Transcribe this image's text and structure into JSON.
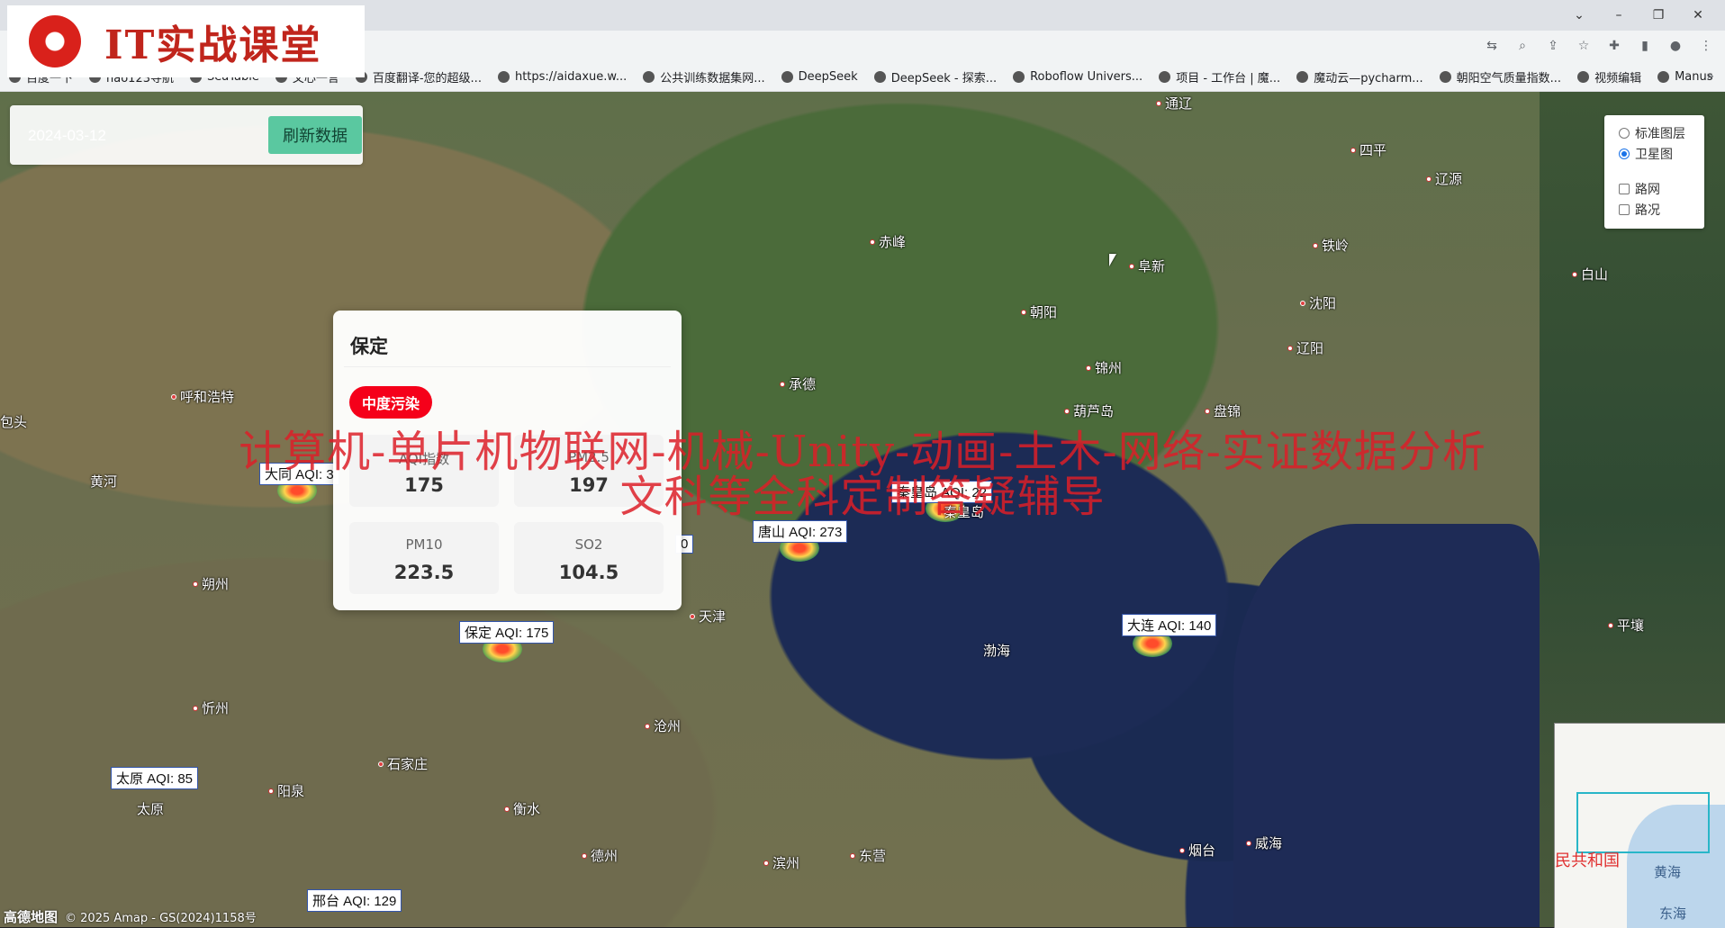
{
  "logo": {
    "text": "IT实战课堂"
  },
  "window": {
    "minimize": "–",
    "restore": "❐",
    "close": "✕",
    "tabs_menu": "⌄"
  },
  "toolbar": {
    "icons": [
      "translate-icon",
      "zoom-icon",
      "share-icon",
      "star-icon",
      "extensions-icon",
      "sidepanel-icon",
      "profile-icon",
      "menu-icon"
    ]
  },
  "bookmarks": [
    {
      "label": "百度一下"
    },
    {
      "label": "hao123导航"
    },
    {
      "label": "SeaTable"
    },
    {
      "label": "文心一言"
    },
    {
      "label": "百度翻译-您的超级..."
    },
    {
      "label": "https://aidaxue.w..."
    },
    {
      "label": "公共训练数据集网..."
    },
    {
      "label": "DeepSeek"
    },
    {
      "label": "DeepSeek - 探索..."
    },
    {
      "label": "Roboflow Univers..."
    },
    {
      "label": "项目 - 工作台 | 魔..."
    },
    {
      "label": "魔动云—pycharm..."
    },
    {
      "label": "朝阳空气质量指数..."
    },
    {
      "label": "视频编辑"
    },
    {
      "label": "Manus"
    }
  ],
  "bookmarks_more": "»",
  "controls": {
    "date_value": "2024-03-12",
    "refresh_label": "刷新数据"
  },
  "layers": {
    "standard": "标准图层",
    "satellite": "卫星图",
    "satellite_selected": true,
    "roadnet": "路网",
    "traffic": "路况"
  },
  "cities": [
    {
      "name": "通辽"
    },
    {
      "name": "四平"
    },
    {
      "name": "辽源"
    },
    {
      "name": "赤峰"
    },
    {
      "name": "铁岭"
    },
    {
      "name": "阜新"
    },
    {
      "name": "白山"
    },
    {
      "name": "沈阳"
    },
    {
      "name": "朝阳"
    },
    {
      "name": "辽阳"
    },
    {
      "name": "锦州"
    },
    {
      "name": "呼和浩特"
    },
    {
      "name": "承德"
    },
    {
      "name": "葫芦岛"
    },
    {
      "name": "盘锦"
    },
    {
      "name": "包头"
    },
    {
      "name": "黄河"
    },
    {
      "name": "秦皇岛"
    },
    {
      "name": "天津"
    },
    {
      "name": "朔州"
    },
    {
      "name": "渤海"
    },
    {
      "name": "平壤"
    },
    {
      "name": "忻州"
    },
    {
      "name": "沧州"
    },
    {
      "name": "石家庄"
    },
    {
      "name": "阳泉"
    },
    {
      "name": "太原"
    },
    {
      "name": "衡水"
    },
    {
      "name": "德州"
    },
    {
      "name": "滨州"
    },
    {
      "name": "东营"
    },
    {
      "name": "烟台"
    },
    {
      "name": "威海"
    }
  ],
  "aqi_labels": [
    {
      "text": "大同 AQI: 3"
    },
    {
      "text": "秦皇岛 AQI: 22"
    },
    {
      "text": "唐山 AQI: 273"
    },
    {
      "text": "0"
    },
    {
      "text": "保定 AQI: 175"
    },
    {
      "text": "大连 AQI: 140"
    },
    {
      "text": "太原 AQI: 85"
    },
    {
      "text": "邢台 AQI: 129"
    }
  ],
  "info_card": {
    "city": "保定",
    "level": "中度污染",
    "level_color": "#f5001a",
    "metrics": [
      {
        "label": "AQI指数",
        "value": "175"
      },
      {
        "label": "PM2.5",
        "value": "197"
      },
      {
        "label": "PM10",
        "value": "223.5"
      },
      {
        "label": "SO2",
        "value": "104.5"
      }
    ]
  },
  "watermark": {
    "line1": "计算机-单片机物联网-机械-Unity-动画-土木-网络-实证数据分析",
    "line2": "文科等全科定制答疑辅导"
  },
  "minimap": {
    "country": "民共和国",
    "sea1": "黄海",
    "sea2": "东海"
  },
  "footer": {
    "brand": "高德地图",
    "copyright": "© 2025 Amap - GS(2024)1158号"
  }
}
